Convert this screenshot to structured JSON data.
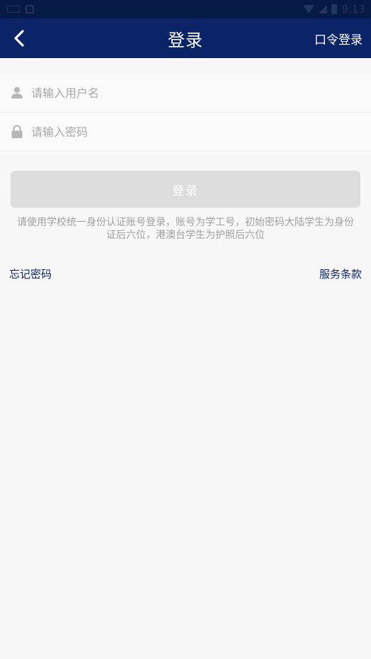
{
  "status_bar": {
    "time": "9:13",
    "icons": [
      "sim-icon",
      "notification-icon",
      "wifi-icon",
      "signal-icon",
      "battery-icon"
    ]
  },
  "nav": {
    "title": "登录",
    "back_icon": "chevron-left-icon",
    "right_action": "口令登录"
  },
  "form": {
    "username": {
      "placeholder": "请输入用户名",
      "value": "",
      "icon": "user-icon"
    },
    "password": {
      "placeholder": "请输入密码",
      "value": "",
      "icon": "lock-icon"
    }
  },
  "login_button": {
    "label": "登录"
  },
  "hint": "请使用学校统一身份认证账号登录，账号为学工号，初始密码大陆学生为身份证后六位，港澳台学生为护照后六位",
  "links": {
    "forgot": "忘记密码",
    "terms": "服务条款"
  },
  "colors": {
    "primary": "#0b2468",
    "status_bar": "#061a46",
    "button_disabled": "#dcdcdc",
    "background": "#f7f7f7"
  }
}
